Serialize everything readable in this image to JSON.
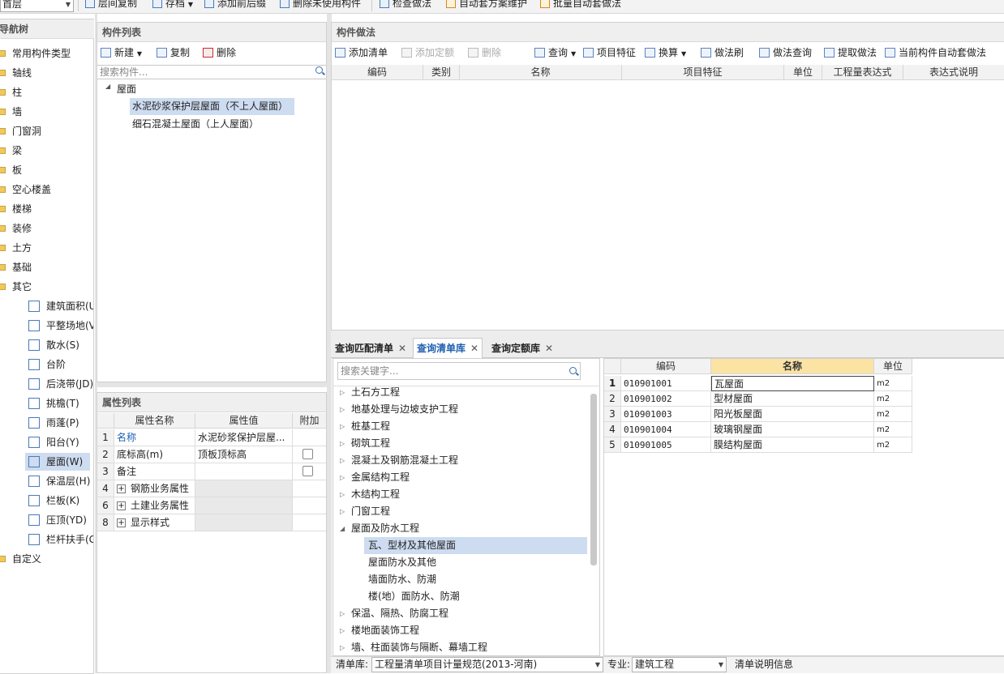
{
  "toolbar": {
    "floor_select": "首层",
    "buttons": [
      "层间复制",
      "存档",
      "添加前后缀",
      "删除未使用构件",
      "检查做法",
      "自动套方案维护",
      "批量自动套做法"
    ]
  },
  "nav": {
    "title": "导航树",
    "items": [
      "常用构件类型",
      "轴线",
      "柱",
      "墙",
      "门窗洞",
      "梁",
      "板",
      "空心楼盖",
      "楼梯",
      "装修",
      "土方",
      "基础",
      "其它"
    ],
    "sub_items": [
      "建筑面积(U)",
      "平整场地(V)",
      "散水(S)",
      "台阶",
      "后浇带(JD)",
      "挑檐(T)",
      "雨蓬(P)",
      "阳台(Y)",
      "屋面(W)",
      "保温层(H)",
      "栏板(K)",
      "压顶(YD)",
      "栏杆扶手(G)"
    ],
    "custom": "自定义"
  },
  "component_list": {
    "title": "构件列表",
    "buttons": [
      "新建",
      "复制",
      "删除"
    ],
    "search_placeholder": "搜索构件...",
    "root": "屋面",
    "children": [
      "水泥砂浆保护层屋面（不上人屋面）",
      "细石混凝土屋面（上人屋面）"
    ]
  },
  "properties": {
    "title": "属性列表",
    "headers": [
      "属性名称",
      "属性值",
      "附加"
    ],
    "rows": [
      {
        "num": "1",
        "name": "名称",
        "value": "水泥砂浆保护层屋..."
      },
      {
        "num": "2",
        "name": "底标高(m)",
        "value": "顶板顶标高"
      },
      {
        "num": "3",
        "name": "备注",
        "value": ""
      },
      {
        "num": "4",
        "name": "钢筋业务属性",
        "value": ""
      },
      {
        "num": "6",
        "name": "土建业务属性",
        "value": ""
      },
      {
        "num": "8",
        "name": "显示样式",
        "value": ""
      }
    ]
  },
  "method": {
    "title": "构件做法",
    "buttons": [
      "添加清单",
      "添加定额",
      "删除",
      "查询",
      "项目特征",
      "换算",
      "做法刷",
      "做法查询",
      "提取做法",
      "当前构件自动套做法"
    ],
    "headers": [
      "编码",
      "类别",
      "名称",
      "项目特征",
      "单位",
      "工程量表达式",
      "表达式说明"
    ]
  },
  "query": {
    "tabs": [
      "查询匹配清单",
      "查询清单库",
      "查询定额库"
    ],
    "search_placeholder": "搜索关键字...",
    "tree": [
      "土石方工程",
      "地基处理与边坡支护工程",
      "桩基工程",
      "砌筑工程",
      "混凝土及钢筋混凝土工程",
      "金属结构工程",
      "木结构工程",
      "门窗工程",
      "屋面及防水工程",
      "保温、隔热、防腐工程",
      "楼地面装饰工程",
      "墙、柱面装饰与隔断、幕墙工程"
    ],
    "tree_sub": [
      "瓦、型材及其他屋面",
      "屋面防水及其他",
      "墙面防水、防潮",
      "楼(地）面防水、防潮"
    ],
    "result_headers": [
      "编码",
      "名称",
      "单位"
    ],
    "results": [
      {
        "num": "1",
        "code": "010901001",
        "name": "瓦屋面",
        "unit": "m2"
      },
      {
        "num": "2",
        "code": "010901002",
        "name": "型材屋面",
        "unit": "m2"
      },
      {
        "num": "3",
        "code": "010901003",
        "name": "阳光板屋面",
        "unit": "m2"
      },
      {
        "num": "4",
        "code": "010901004",
        "name": "玻璃钢屋面",
        "unit": "m2"
      },
      {
        "num": "5",
        "code": "010901005",
        "name": "膜结构屋面",
        "unit": "m2"
      }
    ]
  },
  "bottom": {
    "lib_label": "清单库:",
    "lib_value": "工程量清单项目计量规范(2013-河南)",
    "major_label": "专业:",
    "major_value": "建筑工程",
    "info": "清单说明信息"
  }
}
